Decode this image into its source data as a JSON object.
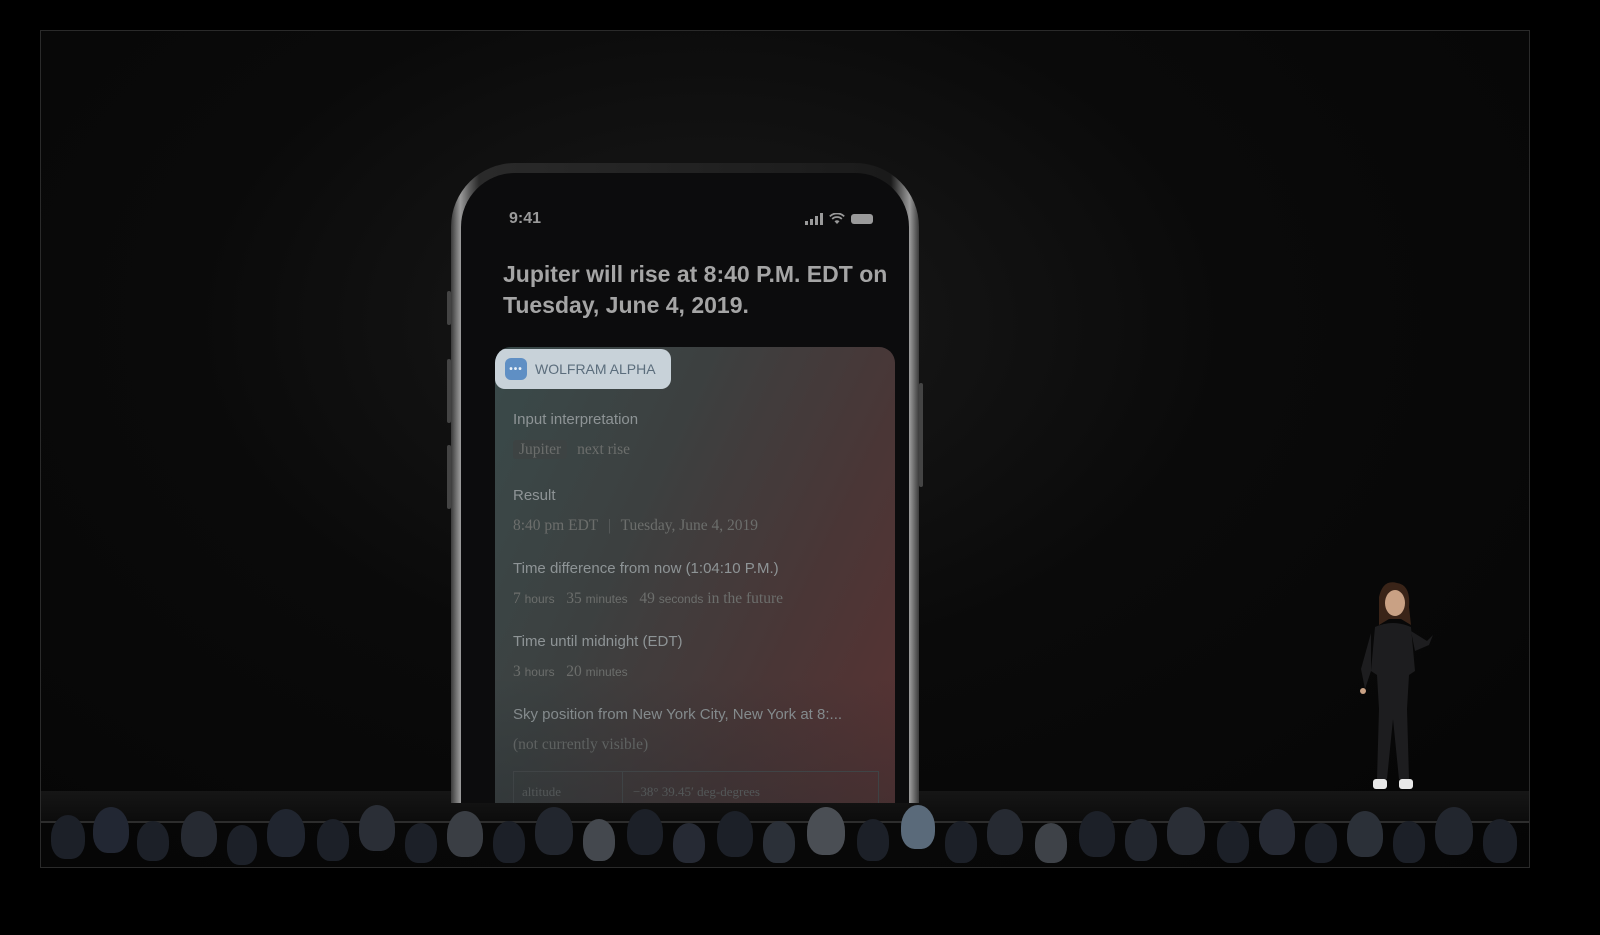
{
  "phone": {
    "status_time": "9:41",
    "siri_response": "Jupiter will rise at 8:40 P.M. EDT on Tuesday, June 4, 2019."
  },
  "card": {
    "source_label": "WOLFRAM ALPHA",
    "source_icon": "wolfram-alpha-icon",
    "input_interpretation": {
      "label": "Input interpretation",
      "tag": "Jupiter",
      "rest": "next rise"
    },
    "result": {
      "label": "Result",
      "time": "8:40 pm EDT",
      "separator": "|",
      "date": "Tuesday, June 4, 2019"
    },
    "time_difference": {
      "label": "Time difference from now (1:04:10 P.M.)",
      "h_val": "7",
      "h_unit": "hours",
      "m_val": "35",
      "m_unit": "minutes",
      "s_val": "49",
      "s_unit": "seconds",
      "suffix": "in the future"
    },
    "until_midnight": {
      "label": "Time until midnight (EDT)",
      "h_val": "3",
      "h_unit": "hours",
      "m_val": "20",
      "m_unit": "minutes"
    },
    "sky_position": {
      "label": "Sky position from New York City, New York at 8:...",
      "value": "(not currently visible)"
    },
    "table": {
      "col1": "altitude",
      "col2": "−38° 39.45′ deg-degrees"
    }
  }
}
